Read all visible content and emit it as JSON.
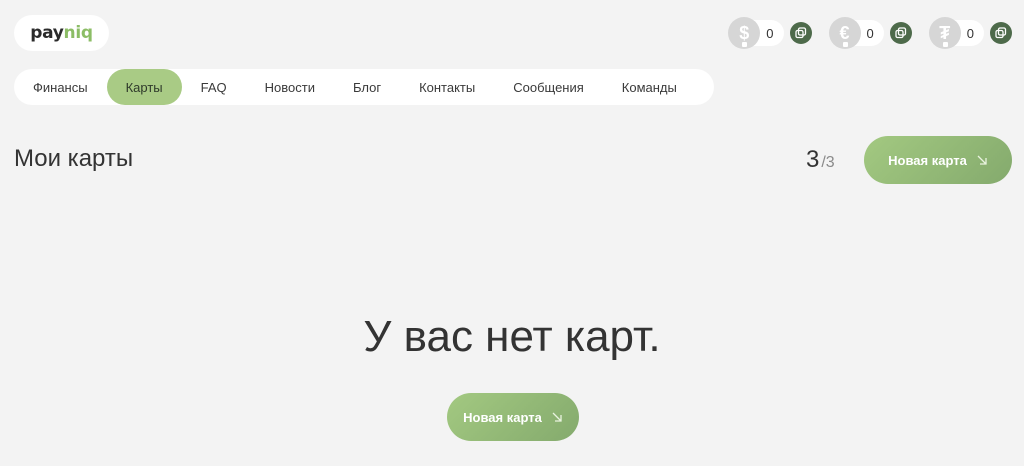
{
  "logo": {
    "part1": "pay",
    "part2": "niq"
  },
  "wallets": [
    {
      "symbol": "$",
      "balance": "0",
      "icon": "dollar-icon"
    },
    {
      "symbol": "€",
      "balance": "0",
      "icon": "euro-icon"
    },
    {
      "symbol": "₮",
      "balance": "0",
      "icon": "tether-icon"
    }
  ],
  "nav": {
    "items": [
      "Финансы",
      "Карты",
      "FAQ",
      "Новости",
      "Блог",
      "Контакты",
      "Сообщения",
      "Команды"
    ],
    "active": "Карты"
  },
  "page": {
    "title": "Мои карты",
    "count": "3",
    "total": "/3",
    "new_card_label": "Новая карта"
  },
  "empty": {
    "message": "У вас нет карт.",
    "button_label": "Новая карта"
  },
  "colors": {
    "accent": "#a9cb85",
    "button_dark": "#4d6a4a",
    "background": "#f3f3f3"
  }
}
